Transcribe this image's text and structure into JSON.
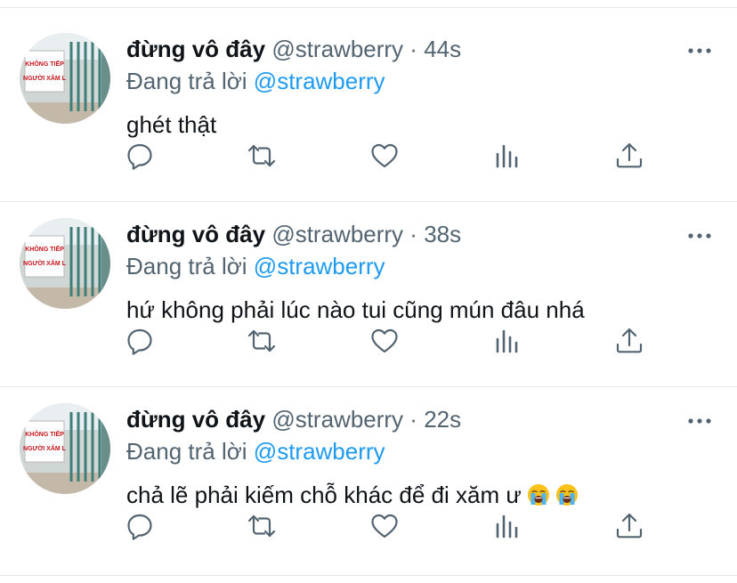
{
  "tweets": [
    {
      "display_name": "đừng vô đây",
      "handle": "@strawberry",
      "separator": "·",
      "time": "44s",
      "reply_prefix": "Đang trả lời",
      "reply_to": "@strawberry",
      "text": "ghét thật",
      "emojis": []
    },
    {
      "display_name": "đừng vô đây",
      "handle": "@strawberry",
      "separator": "·",
      "time": "38s",
      "reply_prefix": "Đang trả lời",
      "reply_to": "@strawberry",
      "text": "hứ không phải lúc nào tui cũng mún đâu nhá",
      "emojis": []
    },
    {
      "display_name": "đừng vô đây",
      "handle": "@strawberry",
      "separator": "·",
      "time": "22s",
      "reply_prefix": "Đang trả lời",
      "reply_to": "@strawberry",
      "text": "chả lẽ phải kiếm chỗ khác để đi xăm ư",
      "emojis": [
        "loudly-crying-face-emoji",
        "loudly-crying-face-emoji"
      ]
    }
  ],
  "avatar_sign_text": [
    "KHÔNG TIẾP",
    "NGƯỜI XĂM L"
  ],
  "icons": [
    "more-icon",
    "reply-icon",
    "retweet-icon",
    "like-icon",
    "analytics-icon",
    "share-icon"
  ],
  "colors": {
    "text": "#0f1419",
    "secondary": "#536471",
    "link": "#1d9bf0",
    "divider": "#e7e9ec"
  }
}
